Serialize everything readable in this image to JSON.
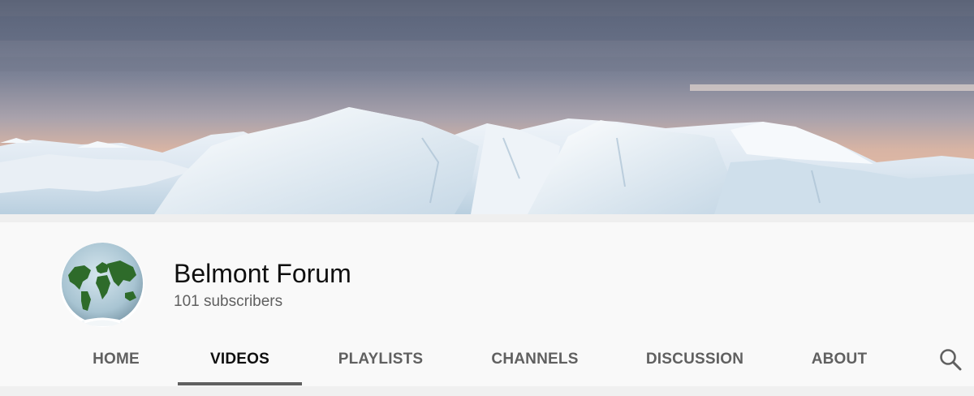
{
  "channel": {
    "name": "Belmont Forum",
    "subscribers": "101 subscribers",
    "avatar_icon": "globe-logo-icon"
  },
  "banner": {
    "description_icon": "iceberg-banner-image"
  },
  "tabs": [
    {
      "label": "HOME",
      "active": false
    },
    {
      "label": "VIDEOS",
      "active": true
    },
    {
      "label": "PLAYLISTS",
      "active": false
    },
    {
      "label": "CHANNELS",
      "active": false
    },
    {
      "label": "DISCUSSION",
      "active": false
    },
    {
      "label": "ABOUT",
      "active": false
    }
  ],
  "search": {
    "icon": "search-icon"
  },
  "colors": {
    "background": "#f9f9f9",
    "text_primary": "#0f0f0f",
    "text_secondary": "#606060",
    "active_tab_underline": "#606060"
  }
}
